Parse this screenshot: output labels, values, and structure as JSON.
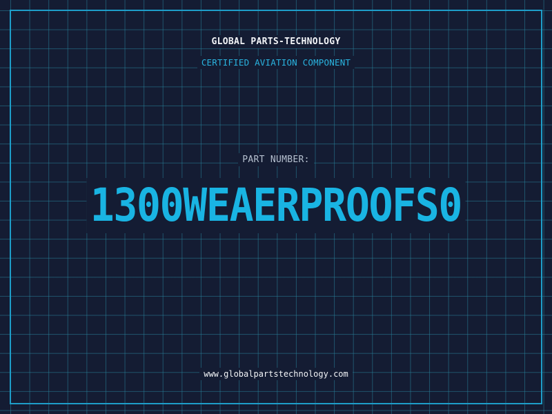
{
  "header": {
    "company": "GLOBAL PARTS-TECHNOLOGY",
    "subtitle": "CERTIFIED AVIATION COMPONENT"
  },
  "part": {
    "label": "PART NUMBER:",
    "number": "1300WEAERPROOFS0"
  },
  "footer": {
    "website": "www.globalpartstechnology.com"
  },
  "colors": {
    "background": "#141c33",
    "grid": "#28829b",
    "accent": "#1e9ec9",
    "part_number": "#19b4e3",
    "text_light": "#f2f4f7"
  }
}
